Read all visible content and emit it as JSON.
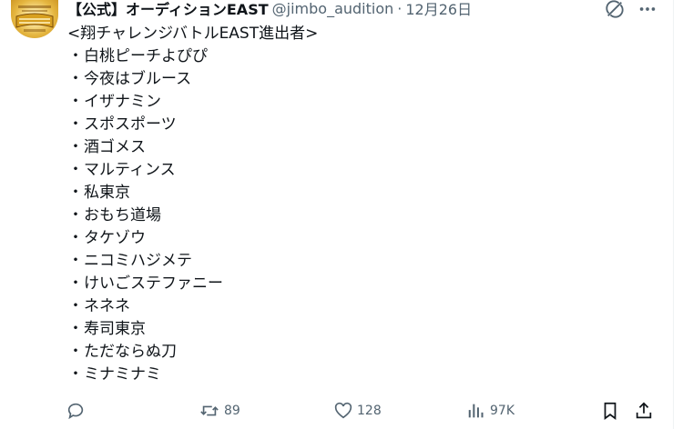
{
  "tweet": {
    "author": {
      "display_name": "【公式】オーディションEAST",
      "handle": "@jimbo_audition",
      "separator": "·",
      "date": "12月26日",
      "avatar_icon": "audition-logo-avatar"
    },
    "header_icons": [
      "grok-icon",
      "more-icon"
    ],
    "body": {
      "heading": "<翔チャレンジバトルEAST進出者>",
      "bullet": "・",
      "items": [
        "白桃ピーチよぴぴ",
        "今夜はブルース",
        "イザナミン",
        "スポスポーツ",
        "酒ゴメス",
        "マルティンス",
        "私東京",
        "おもち道場",
        "タケゾウ",
        "ニコミハジメテ",
        "けいごステファニー",
        "ネネネ",
        "寿司東京",
        "ただならぬ刀",
        "ミナミナミ"
      ]
    },
    "actions": {
      "reply": {
        "icon": "reply-icon",
        "count": ""
      },
      "retweet": {
        "icon": "retweet-icon",
        "count": "89"
      },
      "like": {
        "icon": "heart-icon",
        "count": "128"
      },
      "views": {
        "icon": "views-icon",
        "count": "97K"
      },
      "bookmark": {
        "icon": "bookmark-icon",
        "count": ""
      },
      "share": {
        "icon": "share-icon",
        "count": ""
      }
    }
  },
  "colors": {
    "text": "#0f1419",
    "secondary": "#536471",
    "divider": "#eff3f4"
  }
}
